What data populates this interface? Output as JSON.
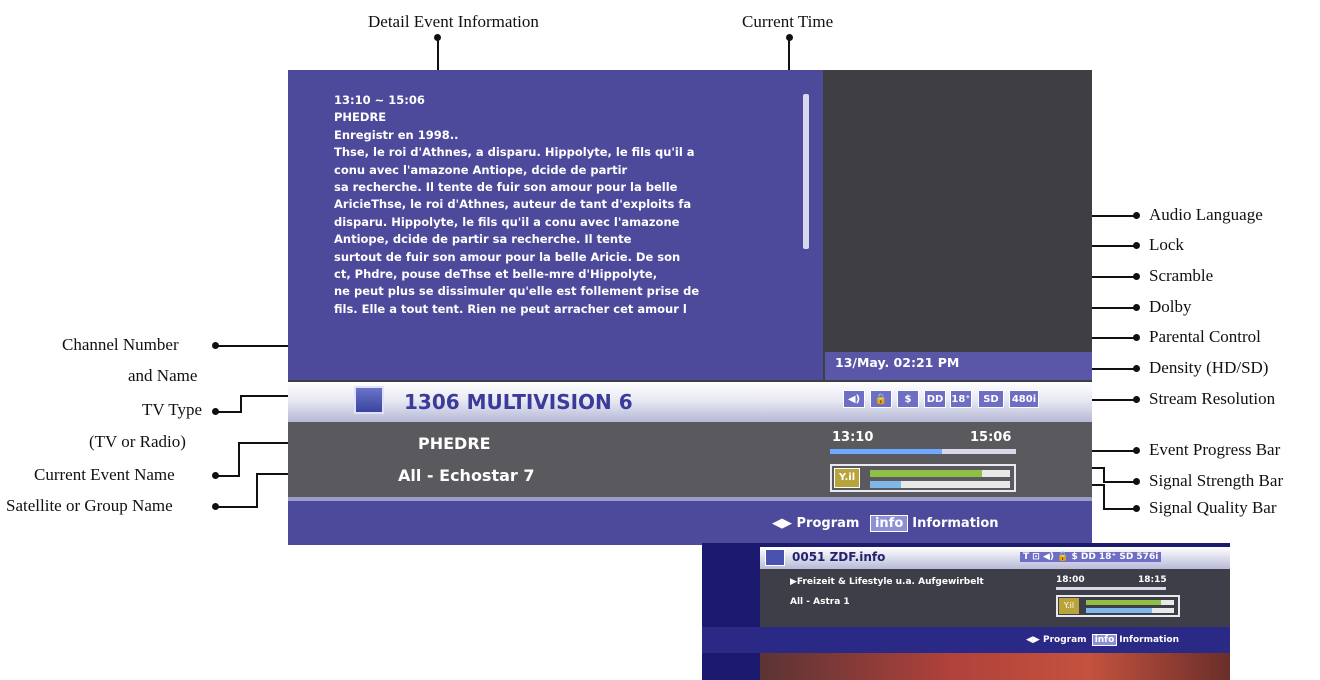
{
  "callouts": {
    "detail_event_information": "Detail Event Information",
    "current_time": "Current Time",
    "audio_language": "Audio Language",
    "lock": "Lock",
    "scramble": "Scramble",
    "dolby": "Dolby",
    "parental_control": "Parental Control",
    "density": "Density (HD/SD)",
    "stream_resolution": "Stream Resolution",
    "event_progress_bar": "Event Progress Bar",
    "signal_strength_bar": "Signal Strength Bar",
    "signal_quality_bar": "Signal Quality Bar",
    "channel_number_1": "Channel Number",
    "channel_number_2": "and Name",
    "tv_type_1": "TV Type",
    "tv_type_2": "(TV or Radio)",
    "current_event_name": "Current Event Name",
    "satellite_group_name": "Satellite or Group Name"
  },
  "screen": {
    "detail_lines": [
      "13:10 ~ 15:06",
      "PHEDRE",
      "Enregistr en 1998..",
      "Thse, le roi d'Athnes, a disparu. Hippolyte, le fils qu'il a",
      "conu avec l'amazone Antiope, dcide de partir",
      " sa recherche. Il tente de fuir son amour pour la belle",
      "AricieThse, le roi d'Athnes, auteur de tant d'exploits fa",
      "disparu. Hippolyte, le fils qu'il a conu avec l'amazone",
      "Antiope, dcide de partir  sa recherche. Il tente",
      "surtout de fuir son amour pour la belle Aricie. De son",
      "ct, Phdre, pouse deThse et belle-mre d'Hippolyte,",
      "ne peut plus se dissimuler qu'elle est follement prise de",
      "fils. Elle a tout tent. Rien ne peut arracher cet amour l"
    ],
    "current_time": "13/May. 02:21 PM",
    "channel": "1306  MULTIVISION 6",
    "status_icons": {
      "audio": "◀)",
      "lock": "🔒",
      "scramble": "$",
      "dolby": "DD",
      "parental": "18⁺",
      "density": "SD",
      "resolution": "480i"
    },
    "event_name": "PHEDRE",
    "group_name": "All - Echostar  7",
    "event_start": "13:10",
    "event_end": "15:06",
    "event_progress": 0.6,
    "signal_icon": "Y.il",
    "signal_strength": 0.8,
    "signal_quality": 0.22,
    "hint_arrows": "◀▶",
    "hint_program": "Program",
    "hint_info": "info",
    "hint_information": "Information"
  },
  "inset": {
    "channel": "0051 ZDF.info",
    "status_icons": "T ⊡ ◀) 🔒 $ DD 18⁺ SD 576i",
    "event": "▶Freizeit & Lifestyle u.a. Aufgewirbelt",
    "group": "All - Astra 1",
    "start": "18:00",
    "end": "18:15",
    "signal_icon": "Y.il",
    "signal_strength": 0.85,
    "signal_quality": 0.75,
    "hint_arrows": "◀▶",
    "hint_program": "Program",
    "hint_info": "info",
    "hint_information": "Information"
  }
}
